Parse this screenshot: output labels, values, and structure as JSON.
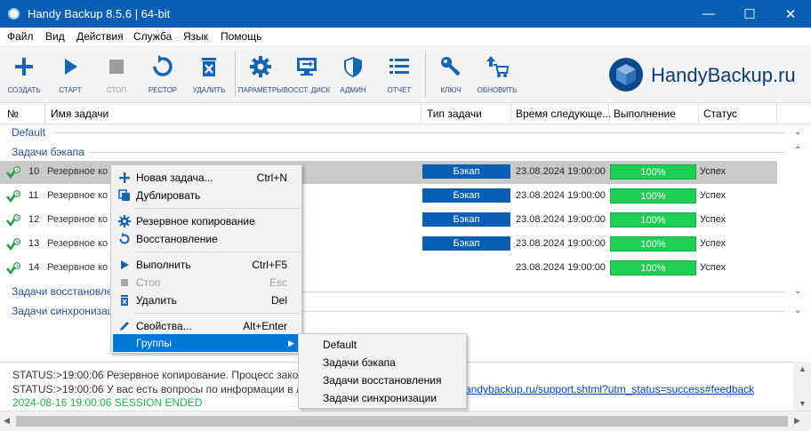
{
  "window": {
    "title": "Handy Backup 8.5.6 | 64-bit",
    "buttons": {
      "minimize": "—",
      "maximize": "☐",
      "close": "✕"
    }
  },
  "menu": [
    "Файл",
    "Вид",
    "Действия",
    "Служба",
    "Язык",
    "Помощь"
  ],
  "toolbar": {
    "create": "СОЗДАТЬ",
    "start": "СТАРТ",
    "stop": "СТОП",
    "restore": "РЕСТОР",
    "delete": "УДАЛИТЬ",
    "settings": "ПАРАМЕТРЫ",
    "restore_disk": "ВОССТ. ДИСК",
    "admin": "АДМИН",
    "report": "ОТЧЕТ",
    "key": "КЛЮЧ",
    "update": "ОБНОВИТЬ",
    "brand": "HandyBackup.ru"
  },
  "columns": {
    "num": "№",
    "name": "Имя задачи",
    "type": "Тип задачи",
    "next": "Время следующе...",
    "progress": "Выполнение",
    "status": "Статус"
  },
  "groups": {
    "default": "Default",
    "backup": "Задачи бэкапа",
    "restore": "Задачи восстановле",
    "sync": "Задачи синхронизаци"
  },
  "rows": [
    {
      "num": "10",
      "name": "Резервное ко",
      "type": "Бэкап",
      "next": "23.08.2024 19:00:00",
      "progress": "100%",
      "status": "Успех"
    },
    {
      "num": "11",
      "name": "Резервное ко",
      "type": "Бэкап",
      "next": "23.08.2024 19:00:00",
      "progress": "100%",
      "status": "Успех"
    },
    {
      "num": "12",
      "name": "Резервное ко",
      "type": "Бэкап",
      "next": "23.08.2024 19:00:00",
      "progress": "100%",
      "status": "Успех"
    },
    {
      "num": "13",
      "name": "Резервное ко",
      "type": "Бэкап",
      "next": "23.08.2024 19:00:00",
      "progress": "100%",
      "status": "Успех"
    },
    {
      "num": "14",
      "name": "Резервное ко",
      "type": "",
      "next": "23.08.2024 19:00:00",
      "progress": "100%",
      "status": "Успех"
    }
  ],
  "context_menu": {
    "new_task": {
      "label": "Новая задача...",
      "shortcut": "Ctrl+N"
    },
    "duplicate": {
      "label": "Дублировать",
      "shortcut": ""
    },
    "backup": {
      "label": "Резервное копирование",
      "shortcut": ""
    },
    "restore": {
      "label": "Восстановление",
      "shortcut": ""
    },
    "run": {
      "label": "Выполнить",
      "shortcut": "Ctrl+F5"
    },
    "stop": {
      "label": "Стоп",
      "shortcut": "Esc"
    },
    "delete": {
      "label": "Удалить",
      "shortcut": "Del"
    },
    "properties": {
      "label": "Свойства...",
      "shortcut": "Alt+Enter"
    },
    "groups": {
      "label": "Группы",
      "shortcut": "▶"
    }
  },
  "submenu": [
    "Default",
    "Задачи бэкапа",
    "Задачи восстановления",
    "Задачи синхронизации"
  ],
  "log": {
    "line1": "STATUS:>19:00:06 Резервное копирование. Процесс законч",
    "line2": "STATUS:>19:00:06 У вас есть вопросы по информации в ло",
    "line2_link": "andybackup.ru/support.shtml?utm_status=success#feedback",
    "line3": "2024-08-16 19:00:06 SESSION ENDED"
  },
  "colors": {
    "titlebar": "#0a5fb4",
    "accent": "#0078d7",
    "type_badge": "#0a5fb4",
    "progress": "#1fcf55",
    "session_ended": "#22b14c"
  }
}
